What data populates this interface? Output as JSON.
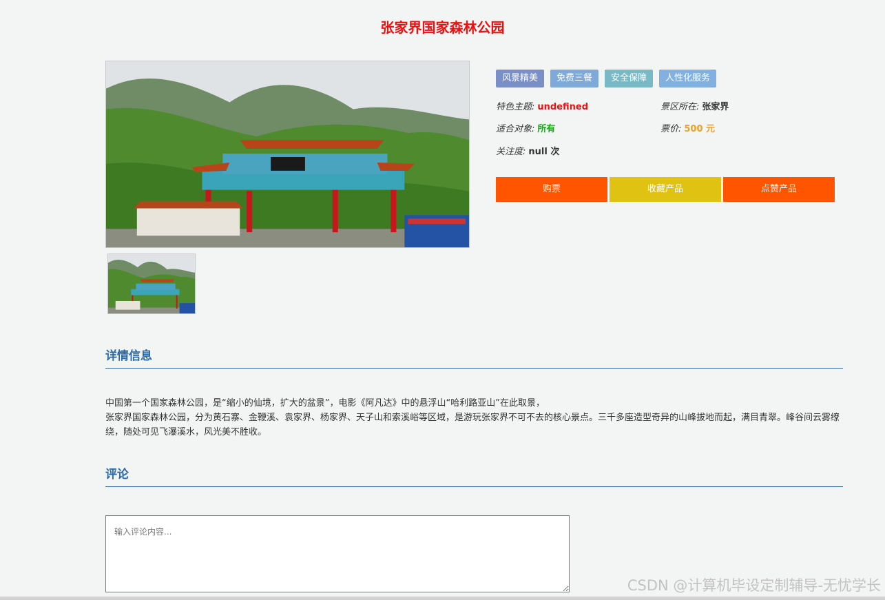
{
  "title": "张家界国家森林公园",
  "tags": [
    {
      "label": "风景精美",
      "color": "#7a8fc7"
    },
    {
      "label": "免费三餐",
      "color": "#7ea9d9"
    },
    {
      "label": "安全保障",
      "color": "#79b9c5"
    },
    {
      "label": "人性化服务",
      "color": "#82b0e0"
    }
  ],
  "info": {
    "theme_label": "特色主题:",
    "theme_value": "undefined",
    "location_label": "景区所在:",
    "location_value": "张家界",
    "audience_label": "适合对象:",
    "audience_value": "所有",
    "price_label": "票价:",
    "price_value": "500 元",
    "attention_label": "关注度:",
    "attention_value": "null 次"
  },
  "buttons": {
    "buy": "购票",
    "favorite": "收藏产品",
    "like": "点赞产品"
  },
  "colors": {
    "buy": "#ff5500",
    "favorite": "#e0c312",
    "like": "#ff5500",
    "title": "#ee1111",
    "section": "#2d6ba8"
  },
  "details": {
    "heading": "详情信息",
    "line1": "中国第一个国家森林公园，是“缩小的仙境，扩大的盆景”，电影《阿凡达》中的悬浮山“哈利路亚山”在此取景，",
    "line2": "张家界国家森林公园，分为黄石寨、金鞭溪、袁家界、杨家界、天子山和索溪峪等区域，是游玩张家界不可不去的核心景点。三千多座造型奇异的山峰拔地而起，满目青翠。峰谷间云雾缭绕，随处可见飞瀑溪水，风光美不胜收。"
  },
  "comments": {
    "heading": "评论",
    "placeholder": "输入评论内容..."
  },
  "watermark": "CSDN @计算机毕设定制辅导-无忧学长"
}
